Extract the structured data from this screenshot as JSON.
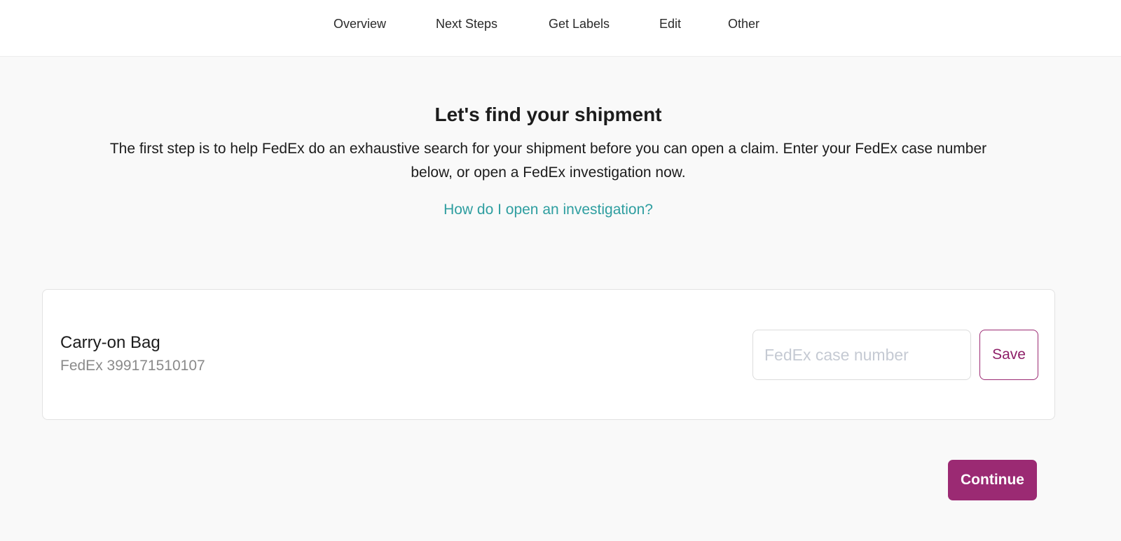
{
  "nav": {
    "items": [
      {
        "label": "Overview"
      },
      {
        "label": "Next Steps"
      },
      {
        "label": "Get Labels"
      },
      {
        "label": "Edit"
      },
      {
        "label": "Other"
      }
    ]
  },
  "main": {
    "title": "Let's find your shipment",
    "description": "The first step is to help FedEx do an exhaustive search for your shipment before you can open a claim. Enter your FedEx case number below, or open a FedEx investigation now.",
    "help_link": "How do I open an investigation?"
  },
  "shipment": {
    "name": "Carry-on Bag",
    "tracking": "FedEx 399171510107",
    "case_input": {
      "value": "",
      "placeholder": "FedEx case number"
    },
    "save_label": "Save"
  },
  "footer": {
    "continue_label": "Continue"
  },
  "colors": {
    "accent": "#9b2a73",
    "link": "#2e9ea0",
    "background": "#f9f9f9"
  }
}
